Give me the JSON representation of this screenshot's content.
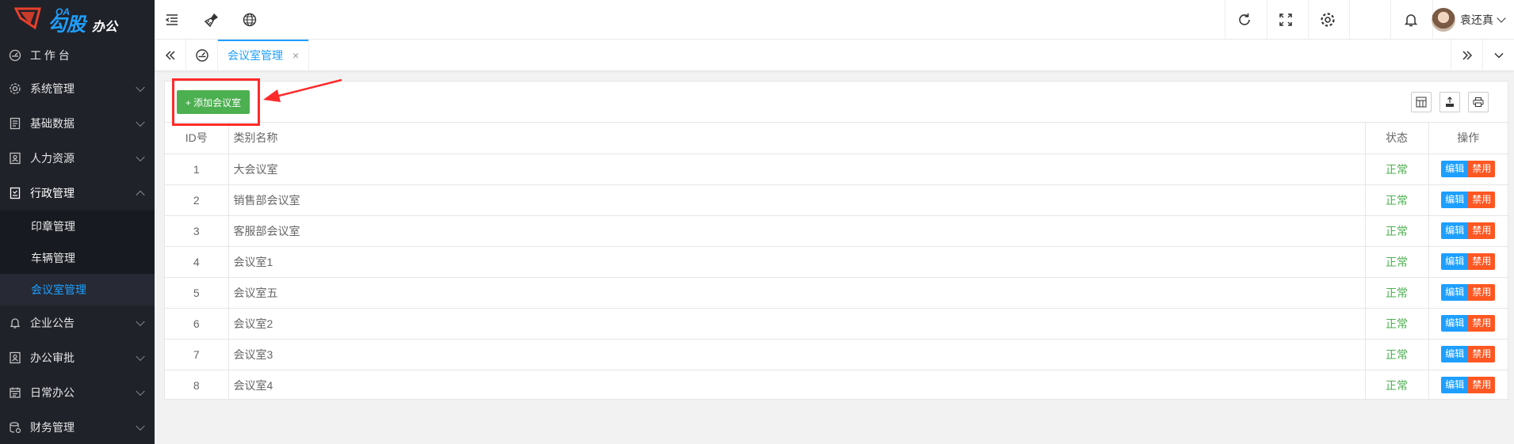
{
  "brand": {
    "logo_text": "勾股",
    "logo_sub": "办公",
    "logo_mark": "OA"
  },
  "sidebar": {
    "items": [
      {
        "label": "工 作 台",
        "icon": "dashboard-icon"
      },
      {
        "label": "系统管理",
        "icon": "settings-icon"
      },
      {
        "label": "基础数据",
        "icon": "document-icon"
      },
      {
        "label": "人力资源",
        "icon": "person-card-icon"
      },
      {
        "label": "行政管理",
        "icon": "admin-icon"
      },
      {
        "label": "企业公告",
        "icon": "bell-icon"
      },
      {
        "label": "办公审批",
        "icon": "approval-icon"
      },
      {
        "label": "日常办公",
        "icon": "calendar-icon"
      },
      {
        "label": "财务管理",
        "icon": "finance-icon"
      }
    ],
    "subitems": [
      {
        "label": "印章管理"
      },
      {
        "label": "车辆管理"
      },
      {
        "label": "会议室管理"
      }
    ]
  },
  "topbar": {
    "user_name": "袁还真"
  },
  "tabs": {
    "active_label": "会议室管理",
    "close_glyph": "×"
  },
  "toolbar": {
    "add_label": "+ 添加会议室"
  },
  "table": {
    "headers": {
      "id": "ID号",
      "name": "类别名称",
      "status": "状态",
      "op": "操作"
    },
    "rows": [
      {
        "id": "1",
        "name": "大会议室",
        "status": "正常",
        "edit": "编辑",
        "disable": "禁用"
      },
      {
        "id": "2",
        "name": "销售部会议室",
        "status": "正常",
        "edit": "编辑",
        "disable": "禁用"
      },
      {
        "id": "3",
        "name": "客服部会议室",
        "status": "正常",
        "edit": "编辑",
        "disable": "禁用"
      },
      {
        "id": "4",
        "name": "会议室1",
        "status": "正常",
        "edit": "编辑",
        "disable": "禁用"
      },
      {
        "id": "5",
        "name": "会议室五",
        "status": "正常",
        "edit": "编辑",
        "disable": "禁用"
      },
      {
        "id": "6",
        "name": "会议室2",
        "status": "正常",
        "edit": "编辑",
        "disable": "禁用"
      },
      {
        "id": "7",
        "name": "会议室3",
        "status": "正常",
        "edit": "编辑",
        "disable": "禁用"
      },
      {
        "id": "8",
        "name": "会议室4",
        "status": "正常",
        "edit": "编辑",
        "disable": "禁用"
      }
    ]
  },
  "colors": {
    "sidebar_bg": "#20222a",
    "accent": "#1e9fff",
    "success": "#4caf50",
    "danger": "#ff5722",
    "annotation": "#ff2a2a"
  }
}
